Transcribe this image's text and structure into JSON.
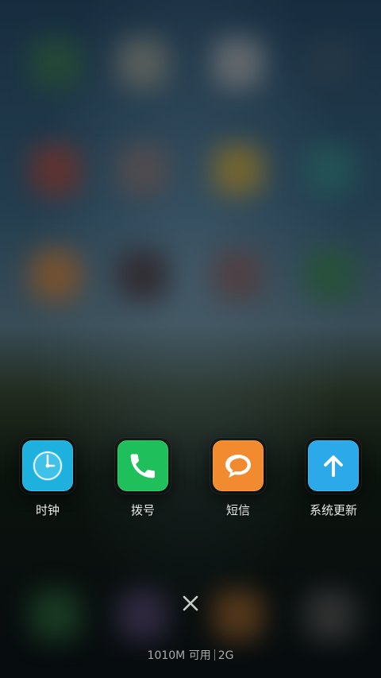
{
  "recent_apps": [
    {
      "id": "clock",
      "label": "时钟",
      "icon": "clock-icon",
      "color": "#1fb1de"
    },
    {
      "id": "dialer",
      "label": "拨号",
      "icon": "phone-icon",
      "color": "#1fbf5b"
    },
    {
      "id": "messages",
      "label": "短信",
      "icon": "chat-bubble-icon",
      "color": "#f28b2f"
    },
    {
      "id": "system_update",
      "label": "系统更新",
      "icon": "arrow-up-icon",
      "color": "#2ca9e8"
    }
  ],
  "close_icon": "close-icon",
  "memory": {
    "available": "1010M 可用",
    "total": "2G"
  }
}
